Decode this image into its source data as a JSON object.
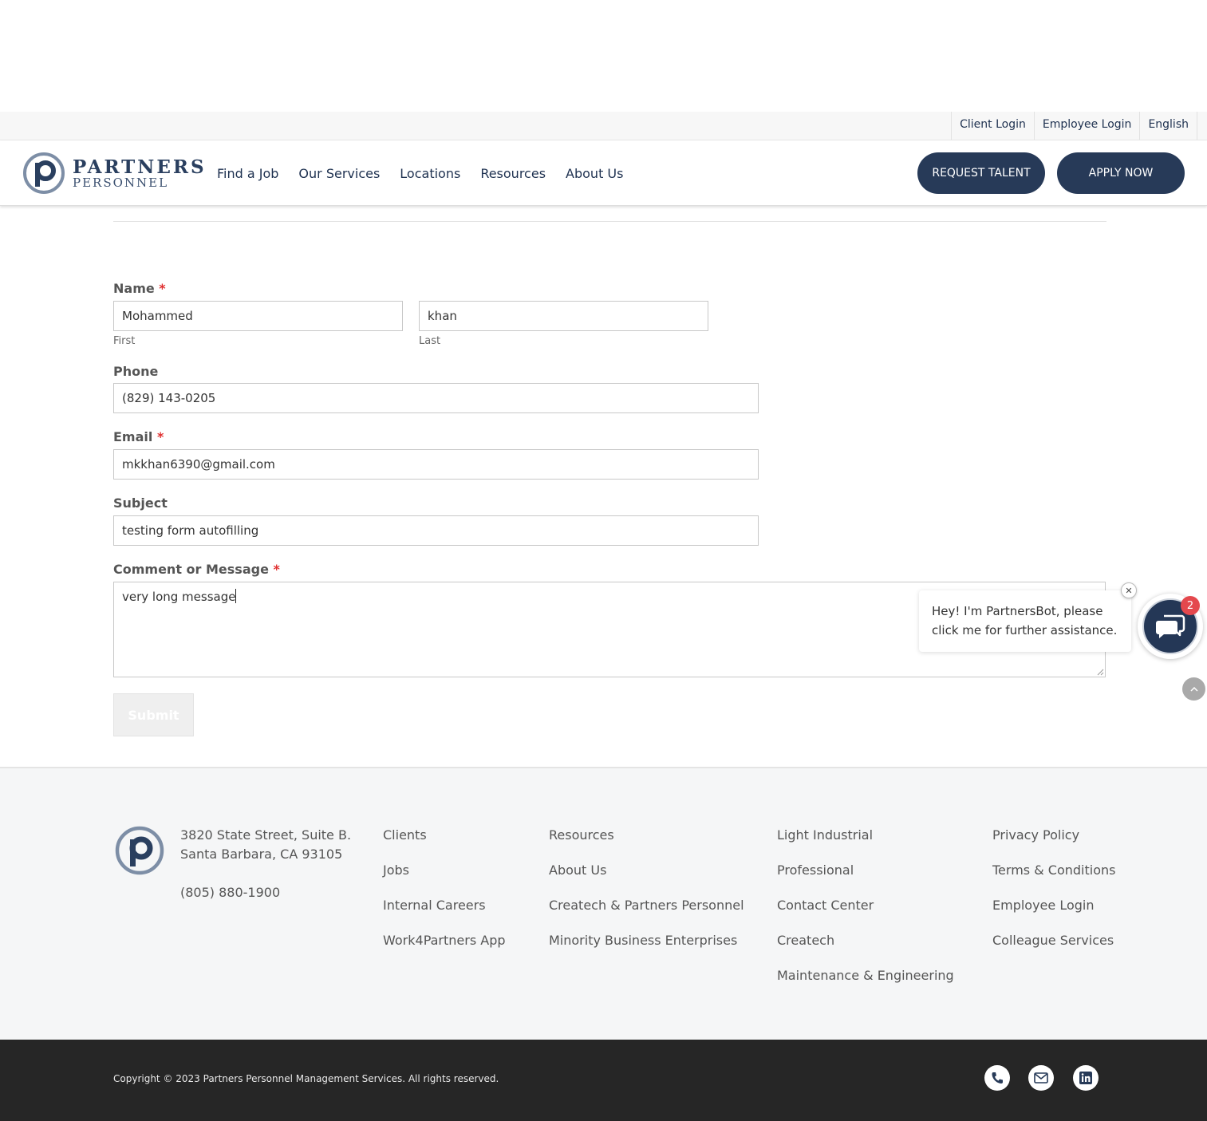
{
  "topbar": {
    "links": [
      "Client Login",
      "Employee Login",
      "English"
    ]
  },
  "header": {
    "logo_line1": "PARTNERS",
    "logo_line2": "PERSONNEL",
    "nav": [
      "Find a Job",
      "Our Services",
      "Locations",
      "Resources",
      "About Us"
    ],
    "request_talent": "REQUEST TALENT",
    "apply_now": "APPLY NOW"
  },
  "form": {
    "name_label": "Name",
    "first_value": "Mohammed",
    "first_sublabel": "First",
    "last_value": "khan",
    "last_sublabel": "Last",
    "phone_label": "Phone",
    "phone_value": "(829) 143-0205",
    "email_label": "Email",
    "email_value": "mkkhan6390@gmail.com",
    "subject_label": "Subject",
    "subject_value": "testing form autofilling",
    "message_label": "Comment or Message",
    "message_value": "very long message",
    "required_mark": "*",
    "submit_label": "Submit"
  },
  "chatbot": {
    "greeting": "Hey! I'm PartnersBot, please click me for further assistance.",
    "close": "✕",
    "badge_count": "2"
  },
  "footer": {
    "address_line1": "3820 State Street, Suite B.",
    "address_line2": "Santa Barbara, CA 93105",
    "phone": "(805) 880-1900",
    "col1": [
      "Clients",
      "Jobs",
      "Internal Careers",
      "Work4Partners App"
    ],
    "col2": [
      "Resources",
      "About Us",
      "Createch & Partners Personnel",
      "Minority Business Enterprises"
    ],
    "col3": [
      "Light Industrial",
      "Professional",
      "Contact Center",
      "Createch",
      "Maintenance & Engineering"
    ],
    "col4": [
      "Privacy Policy",
      "Terms & Conditions",
      "Employee Login",
      "Colleague Services"
    ]
  },
  "bottombar": {
    "copyright": "Copyright © 2023 Partners Personnel Management Services. All rights reserved.",
    "social_icons": [
      "phone-icon",
      "mail-icon",
      "linkedin-icon"
    ]
  },
  "colors": {
    "brand_navy": "#273a58",
    "required_red": "#e03030",
    "badge_red": "#e4484d"
  }
}
